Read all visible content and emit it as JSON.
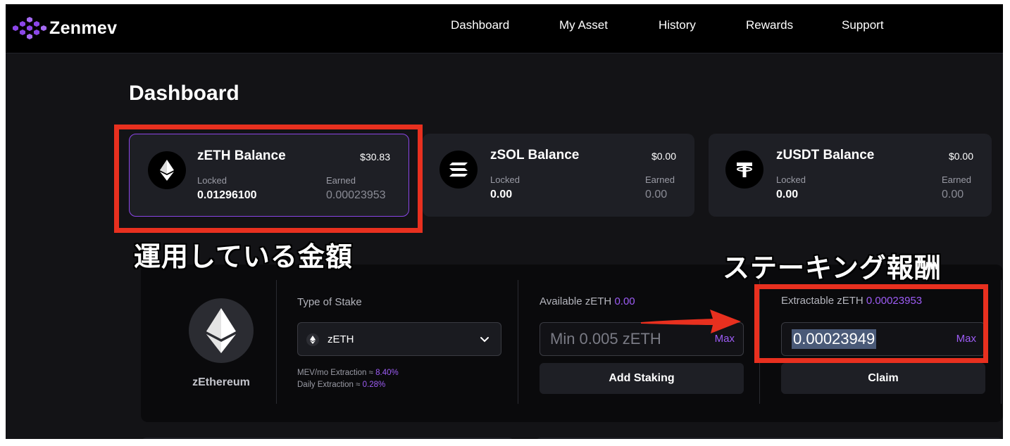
{
  "brand": {
    "name": "Zenmev",
    "logo": "purple-cube-cluster-logo"
  },
  "nav": {
    "items": [
      {
        "label": "Dashboard"
      },
      {
        "label": "My Asset"
      },
      {
        "label": "History"
      },
      {
        "label": "Rewards"
      },
      {
        "label": "Support"
      }
    ]
  },
  "page": {
    "title": "Dashboard"
  },
  "balances": [
    {
      "name": "zETH Balance",
      "usd": "$30.83",
      "locked_label": "Locked",
      "locked": "0.01296100",
      "earned_label": "Earned",
      "earned": "0.00023953",
      "icon": "ethereum-icon"
    },
    {
      "name": "zSOL Balance",
      "usd": "$0.00",
      "locked_label": "Locked",
      "locked": "0.00",
      "earned_label": "Earned",
      "earned": "0.00",
      "icon": "solana-icon"
    },
    {
      "name": "zUSDT Balance",
      "usd": "$0.00",
      "locked_label": "Locked",
      "locked": "0.00",
      "earned_label": "Earned",
      "earned": "0.00",
      "icon": "tether-icon"
    }
  ],
  "staking": {
    "token_name": "zEthereum",
    "type_label": "Type of Stake",
    "type_value": "zETH",
    "mev_label": "MEV/mo Extraction ≈",
    "mev_value": "8.40%",
    "daily_label": "Daily Extraction ≈",
    "daily_value": "0.28%",
    "available_label": "Available zETH",
    "available_value": "0.00",
    "stake_placeholder": "Min 0.005 zETH",
    "max_label": "Max",
    "add_button": "Add Staking",
    "extractable_label": "Extractable zETH",
    "extractable_value": "0.00023953",
    "claim_value": "0.00023949",
    "claim_button": "Claim"
  },
  "annotations": {
    "invested_amount": "運用している金額",
    "staking_reward": "ステーキング報酬",
    "highlight_color": "#e8301f"
  },
  "colors": {
    "accent": "#8b46e8",
    "background": "#131316",
    "nav": "#000000",
    "card": "#1e1f25"
  }
}
